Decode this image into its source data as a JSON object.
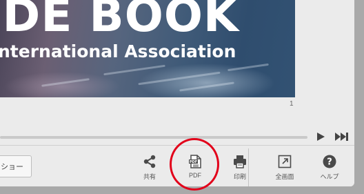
{
  "cover": {
    "title": "IDE BOOK",
    "subtitle": "nternational Association"
  },
  "viewer": {
    "page_number": "1",
    "progress_fraction": 0.0
  },
  "controls": {
    "play_icon": "play-icon",
    "last_icon": "skip-to-end-icon"
  },
  "toolbar": {
    "slideshow_label": "ショー",
    "share_label": "共有",
    "pdf_label": "PDF",
    "print_label": "印刷",
    "fullscreen_label": "全画面",
    "help_label": "ヘルプ"
  },
  "colors": {
    "highlight": "#e2001a",
    "icon": "#4a4a4a"
  }
}
